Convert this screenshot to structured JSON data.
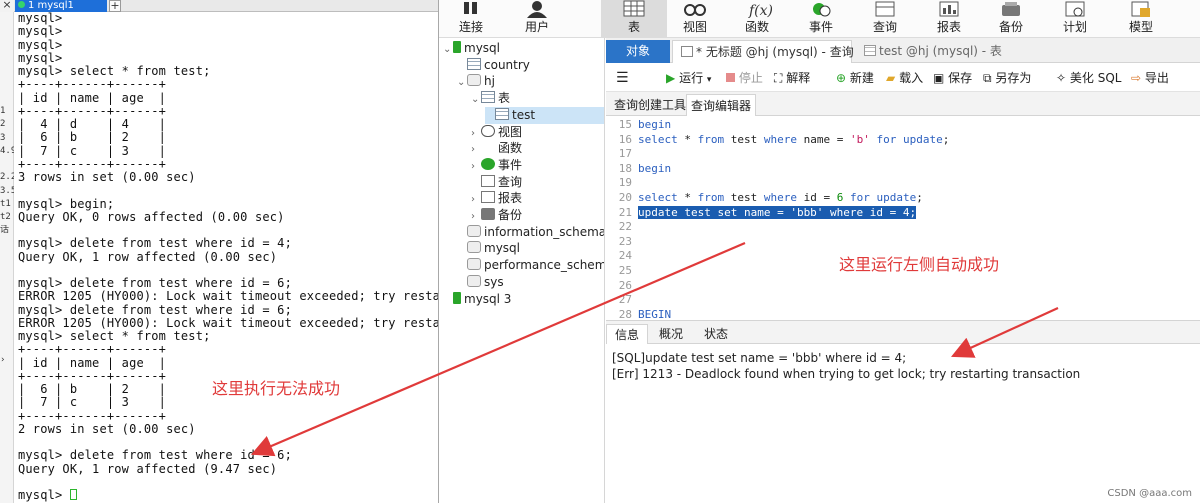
{
  "terminal": {
    "tab_close": "×",
    "tab_title": "1 mysql1",
    "tab_add": "+",
    "gutter": [
      "1",
      "2",
      "3",
      "4.9",
      "2.2",
      "3.5",
      "t1",
      "t2",
      "话"
    ],
    "lines": [
      "mysql>",
      "mysql>",
      "mysql>",
      "mysql>",
      "mysql> select * from test;",
      "+----+------+------+",
      "| id | name | age  |",
      "+----+------+------+",
      "|  4 | d    | 4    |",
      "|  6 | b    | 2    |",
      "|  7 | c    | 3    |",
      "+----+------+------+",
      "3 rows in set (0.00 sec)",
      "",
      "mysql> begin;",
      "Query OK, 0 rows affected (0.00 sec)",
      "",
      "mysql> delete from test where id = 4;",
      "Query OK, 1 row affected (0.00 sec)",
      "",
      "mysql> delete from test where id = 6;",
      "ERROR 1205 (HY000): Lock wait timeout exceeded; try resta",
      "mysql> delete from test where id = 6;",
      "ERROR 1205 (HY000): Lock wait timeout exceeded; try resta",
      "mysql> select * from test;",
      "+----+------+------+",
      "| id | name | age  |",
      "+----+------+------+",
      "|  6 | b    | 2    |",
      "|  7 | c    | 3    |",
      "+----+------+------+",
      "2 rows in set (0.00 sec)",
      "",
      "mysql> delete from test where id = 6;",
      "Query OK, 1 row affected (9.47 sec)",
      "",
      "mysql> "
    ],
    "annotation": "这里执行无法成功"
  },
  "navicat": {
    "toolbar": [
      {
        "label": "连接",
        "icon": "connection-icon"
      },
      {
        "label": "用户",
        "icon": "user-icon"
      },
      {
        "label": "表",
        "icon": "table-icon"
      },
      {
        "label": "视图",
        "icon": "view-icon"
      },
      {
        "label": "函数",
        "icon": "function-icon"
      },
      {
        "label": "事件",
        "icon": "event-icon"
      },
      {
        "label": "查询",
        "icon": "query-icon"
      },
      {
        "label": "报表",
        "icon": "report-icon"
      },
      {
        "label": "备份",
        "icon": "backup-icon"
      },
      {
        "label": "计划",
        "icon": "schedule-icon"
      },
      {
        "label": "模型",
        "icon": "model-icon"
      }
    ],
    "tree": [
      {
        "label": "mysql",
        "chevron": "v"
      },
      {
        "label": "country",
        "chevron": ""
      },
      {
        "label": "hj",
        "chevron": "v"
      },
      {
        "label": "表",
        "chevron": "v"
      },
      {
        "label": "test",
        "chevron": ""
      },
      {
        "label": "视图",
        "chevron": ">"
      },
      {
        "label": "函数",
        "chevron": ">"
      },
      {
        "label": "事件",
        "chevron": ">"
      },
      {
        "label": "查询",
        "chevron": ""
      },
      {
        "label": "报表",
        "chevron": ">"
      },
      {
        "label": "备份",
        "chevron": ">"
      },
      {
        "label": "information_schema",
        "chevron": ""
      },
      {
        "label": "mysql",
        "chevron": ""
      },
      {
        "label": "performance_schema",
        "chevron": ""
      },
      {
        "label": "sys",
        "chevron": ""
      },
      {
        "label": "mysql 3",
        "chevron": ""
      }
    ],
    "doc_tabs": {
      "objects": "对象",
      "query": "* 无标题 @hj (mysql) - 查询",
      "table": "test @hj (mysql) - 表"
    },
    "query_toolbar": {
      "menu": "☰",
      "run": "运行",
      "stop": "停止",
      "explain": "解释",
      "new": "新建",
      "load": "载入",
      "save": "保存",
      "save_as": "另存为",
      "beautify": "美化 SQL",
      "export": "导出"
    },
    "sub_tabs": [
      "查询创建工具",
      "查询编辑器"
    ],
    "editor": {
      "lines": [
        {
          "n": "15",
          "text": "begin"
        },
        {
          "n": "16",
          "text": "select * from test where name = 'b' for update;"
        },
        {
          "n": "17",
          "text": ""
        },
        {
          "n": "18",
          "text": "begin"
        },
        {
          "n": "19",
          "text": ""
        },
        {
          "n": "20",
          "text": "select * from test where id = 6 for update;"
        },
        {
          "n": "21",
          "text": "update test set name = 'bbb' where id = 4;"
        },
        {
          "n": "22",
          "text": ""
        },
        {
          "n": "23",
          "text": ""
        },
        {
          "n": "24",
          "text": ""
        },
        {
          "n": "25",
          "text": ""
        },
        {
          "n": "26",
          "text": ""
        },
        {
          "n": "27",
          "text": ""
        },
        {
          "n": "28",
          "text": "BEGIN"
        }
      ],
      "highlighted_line": "21"
    },
    "annotation": "这里运行左侧自动成功",
    "info_tabs": [
      "信息",
      "概况",
      "状态"
    ],
    "info_lines": [
      "[SQL]update test set name = 'bbb' where id = 4;",
      "[Err] 1213 - Deadlock found when trying to get lock; try restarting transaction"
    ]
  },
  "watermark": "CSDN @aaa.com",
  "colors": {
    "annotation_red": "#e03a3a",
    "selection_blue": "#1a5cb0",
    "objects_tab_blue": "#2b74c8"
  }
}
